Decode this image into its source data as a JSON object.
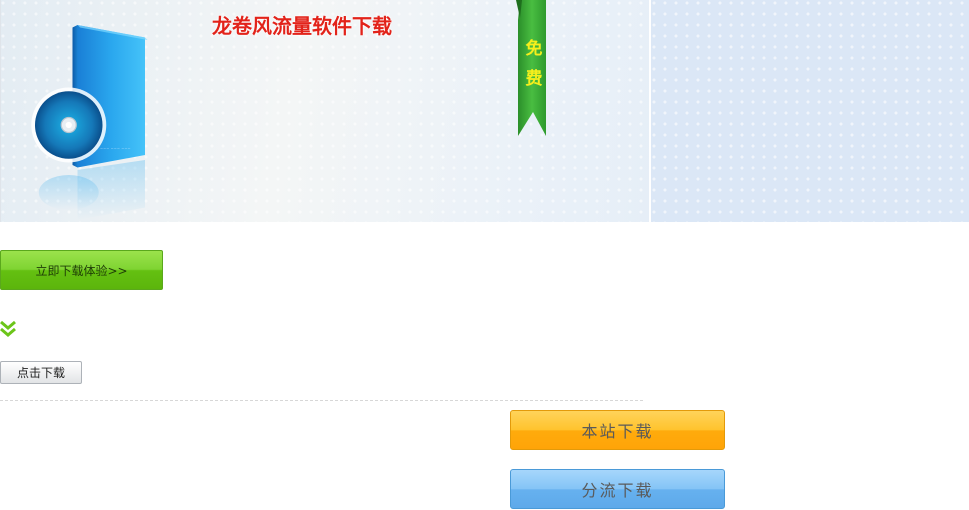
{
  "banner": {
    "title": "龙卷风流量软件下载",
    "ribbon_chars": [
      "免",
      "费"
    ]
  },
  "buttons": {
    "download_experience": "立即下载体验>>",
    "click_download": "点击下载",
    "local_download": "本站下载",
    "mirror_download": "分流下载"
  },
  "icons": {
    "product_box": "software-box-icon",
    "disc": "cd-disc-icon",
    "chevrons": "double-chevron-down-icon",
    "ribbon": "free-ribbon-icon"
  },
  "colors": {
    "title_red": "#e2231a",
    "green_button": "#6cc51a",
    "orange_button": "#ffb21a",
    "blue_button": "#72b9f2",
    "ribbon_green": "#3aa93a",
    "ribbon_text": "#f6ef1c"
  }
}
